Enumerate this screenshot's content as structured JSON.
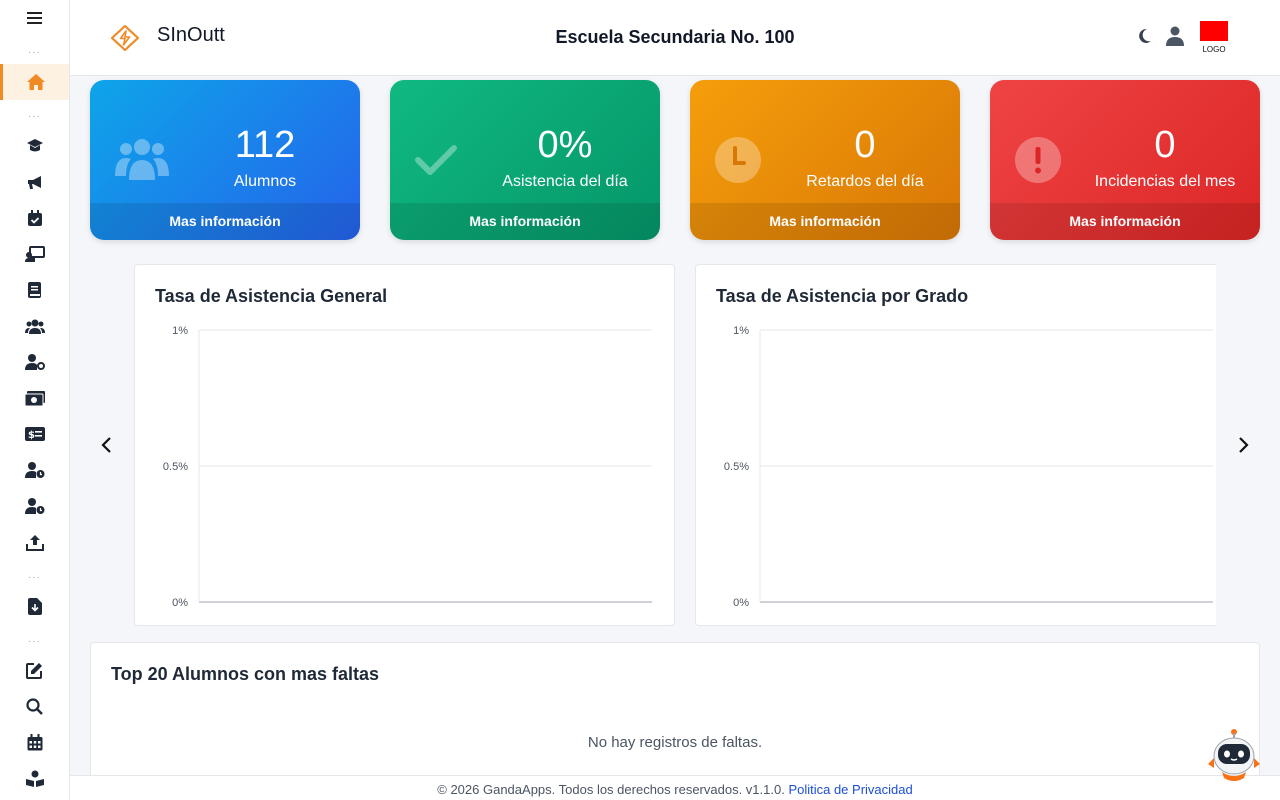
{
  "app": {
    "brand": "SInOutt",
    "school": "Escuela Secundaria No. 100",
    "logo_text": "LOGO"
  },
  "sidebar": {
    "items": [
      {
        "icon": "menu-icon"
      },
      {
        "icon": "home-icon",
        "active": true
      },
      {
        "icon": "graduation-cap-icon"
      },
      {
        "icon": "megaphone-icon"
      },
      {
        "icon": "calendar-check-icon"
      },
      {
        "icon": "chalkboard-teacher-icon"
      },
      {
        "icon": "book-icon"
      },
      {
        "icon": "users-icon"
      },
      {
        "icon": "user-gear-icon"
      },
      {
        "icon": "money-icon"
      },
      {
        "icon": "money-check-icon"
      },
      {
        "icon": "user-clock-icon"
      },
      {
        "icon": "user-clock-icon-2"
      },
      {
        "icon": "upload-icon"
      },
      {
        "icon": "file-download-icon"
      },
      {
        "icon": "edit-icon"
      },
      {
        "icon": "search-icon"
      },
      {
        "icon": "calendar-icon"
      },
      {
        "icon": "reader-icon"
      }
    ]
  },
  "cards": [
    {
      "value": "112",
      "label": "Alumnos",
      "footer": "Mas información",
      "color": "#2563eb",
      "icon": "users-icon"
    },
    {
      "value": "0%",
      "label": "Asistencia del día",
      "footer": "Mas información",
      "color": "#059669",
      "icon": "check-icon"
    },
    {
      "value": "0",
      "label": "Retardos del día",
      "footer": "Mas información",
      "color": "#d97706",
      "icon": "clock-icon"
    },
    {
      "value": "0",
      "label": "Incidencias del mes",
      "footer": "Mas información",
      "color": "#dc2626",
      "icon": "alert-icon"
    }
  ],
  "chart_data": [
    {
      "type": "bar",
      "title": "Tasa de Asistencia General",
      "categories": [],
      "series": [],
      "ylim": [
        0,
        1
      ],
      "yticks": [
        "1%",
        "0.5%",
        "0%"
      ],
      "grid": true
    },
    {
      "type": "bar",
      "title": "Tasa de Asistencia por Grado",
      "categories": [],
      "series": [],
      "ylim": [
        0,
        1
      ],
      "yticks": [
        "1%",
        "0.5%",
        "0%"
      ],
      "grid": true
    }
  ],
  "top20": {
    "title": "Top 20 Alumnos con mas faltas",
    "empty": "No hay registros de faltas."
  },
  "footer": {
    "text": "© 2026 GandaApps. Todos los derechos reservados. v1.1.0. ",
    "link": "Politica de Privacidad"
  }
}
